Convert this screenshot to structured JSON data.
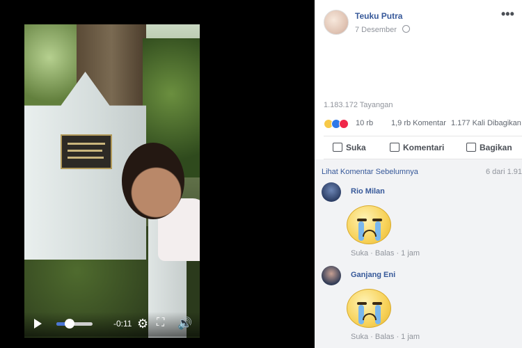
{
  "post": {
    "author": "Teuku Putra",
    "date": "7 Desember",
    "views": "1.183.172 Tayangan",
    "reaction_count": "10 rb",
    "comments_count": "1,9 rb Komentar",
    "shares_count": "1.177 Kali Dibagikan"
  },
  "actions": {
    "like": "Suka",
    "comment": "Komentari",
    "share": "Bagikan"
  },
  "comments_section": {
    "more_label": "Lihat Komentar Sebelumnya",
    "pager": "6 dari 1.91",
    "items": [
      {
        "name": "Rio Milan",
        "like": "Suka",
        "reply": "Balas",
        "time": "1 jam"
      },
      {
        "name": "Ganjang Eni",
        "like": "Suka",
        "reply": "Balas",
        "time": "1 jam"
      }
    ]
  },
  "video": {
    "time_remaining": "-0:11",
    "volume_level": 0.4
  },
  "icons": {
    "play": "play-icon",
    "settings": "gear-icon",
    "fullscreen": "expand-icon",
    "volume": "speaker-icon",
    "privacy": "globe-icon",
    "menu": "more-icon"
  },
  "colors": {
    "link": "#365899",
    "meta": "#90949c",
    "comment_bg": "#f2f3f5"
  }
}
